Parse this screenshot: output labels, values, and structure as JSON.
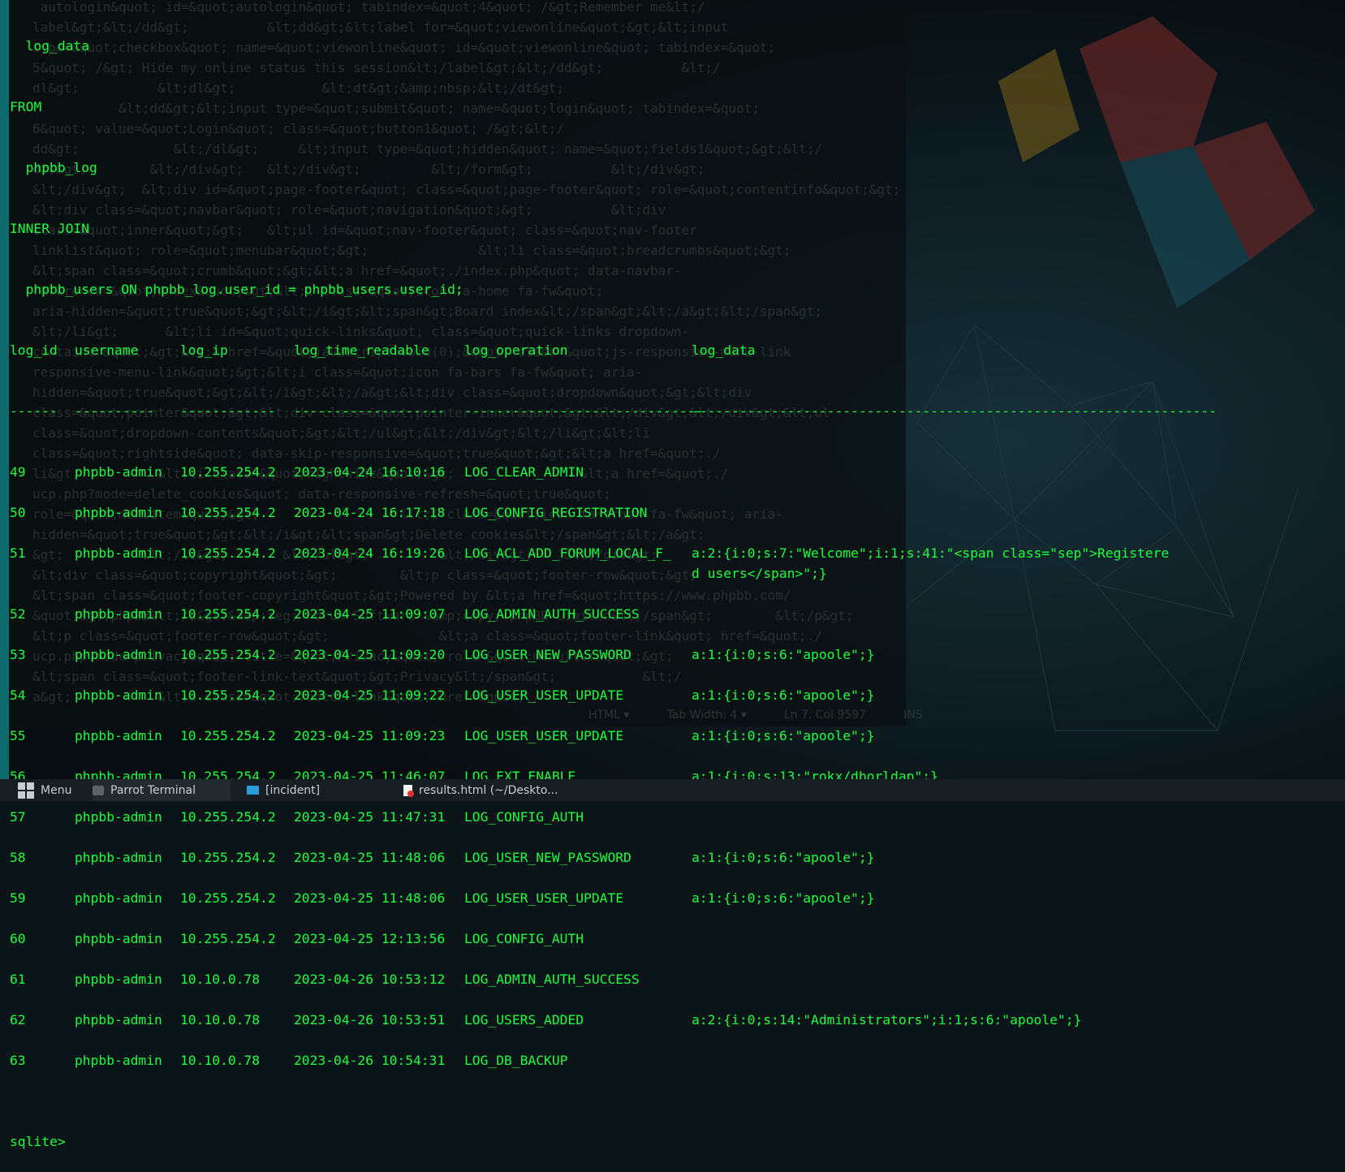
{
  "terminal": {
    "lines": [
      "  log_data",
      "FROM",
      "  phpbb_log",
      "INNER JOIN",
      "  phpbb_users ON phpbb_log.user_id = phpbb_users.user_id;"
    ],
    "columns": [
      "log_id",
      "username",
      "log_ip",
      "log_time_readable",
      "log_operation",
      "log_data"
    ],
    "separators": [
      "------",
      "----------",
      "------------",
      "-------------------",
      "------------------------------",
      "------------------------------------------------------------------"
    ],
    "rows": [
      {
        "log_id": "49",
        "username": "phpbb-admin",
        "log_ip": "10.255.254.2",
        "time": "2023-04-24 16:10:16",
        "operation": "LOG_CLEAR_ADMIN",
        "data": ""
      },
      {
        "log_id": "50",
        "username": "phpbb-admin",
        "log_ip": "10.255.254.2",
        "time": "2023-04-24 16:17:18",
        "operation": "LOG_CONFIG_REGISTRATION",
        "data": ""
      },
      {
        "log_id": "51",
        "username": "phpbb-admin",
        "log_ip": "10.255.254.2",
        "time": "2023-04-24 16:19:26",
        "operation": "LOG_ACL_ADD_FORUM_LOCAL_F_",
        "data": "a:2:{i:0;s:7:\"Welcome\";i:1;s:41:\"<span class=\"sep\">Registere",
        "data2": "d users</span>\";}"
      },
      {
        "log_id": "52",
        "username": "phpbb-admin",
        "log_ip": "10.255.254.2",
        "time": "2023-04-25 11:09:07",
        "operation": "LOG_ADMIN_AUTH_SUCCESS",
        "data": ""
      },
      {
        "log_id": "53",
        "username": "phpbb-admin",
        "log_ip": "10.255.254.2",
        "time": "2023-04-25 11:09:20",
        "operation": "LOG_USER_NEW_PASSWORD",
        "data": "a:1:{i:0;s:6:\"apoole\";}"
      },
      {
        "log_id": "54",
        "username": "phpbb-admin",
        "log_ip": "10.255.254.2",
        "time": "2023-04-25 11:09:22",
        "operation": "LOG_USER_USER_UPDATE",
        "data": "a:1:{i:0;s:6:\"apoole\";}"
      },
      {
        "log_id": "55",
        "username": "phpbb-admin",
        "log_ip": "10.255.254.2",
        "time": "2023-04-25 11:09:23",
        "operation": "LOG_USER_USER_UPDATE",
        "data": "a:1:{i:0;s:6:\"apoole\";}"
      },
      {
        "log_id": "56",
        "username": "phpbb-admin",
        "log_ip": "10.255.254.2",
        "time": "2023-04-25 11:46:07",
        "operation": "LOG_EXT_ENABLE",
        "data": "a:1:{i:0;s:13:\"rokx/dborldap\";}"
      },
      {
        "log_id": "57",
        "username": "phpbb-admin",
        "log_ip": "10.255.254.2",
        "time": "2023-04-25 11:47:31",
        "operation": "LOG_CONFIG_AUTH",
        "data": ""
      },
      {
        "log_id": "58",
        "username": "phpbb-admin",
        "log_ip": "10.255.254.2",
        "time": "2023-04-25 11:48:06",
        "operation": "LOG_USER_NEW_PASSWORD",
        "data": "a:1:{i:0;s:6:\"apoole\";}"
      },
      {
        "log_id": "59",
        "username": "phpbb-admin",
        "log_ip": "10.255.254.2",
        "time": "2023-04-25 11:48:06",
        "operation": "LOG_USER_USER_UPDATE",
        "data": "a:1:{i:0;s:6:\"apoole\";}"
      },
      {
        "log_id": "60",
        "username": "phpbb-admin",
        "log_ip": "10.255.254.2",
        "time": "2023-04-25 12:13:56",
        "operation": "LOG_CONFIG_AUTH",
        "data": ""
      },
      {
        "log_id": "61",
        "username": "phpbb-admin",
        "log_ip": "10.10.0.78",
        "time": "2023-04-26 10:53:12",
        "operation": "LOG_ADMIN_AUTH_SUCCESS",
        "data": ""
      },
      {
        "log_id": "62",
        "username": "phpbb-admin",
        "log_ip": "10.10.0.78",
        "time": "2023-04-26 10:53:51",
        "operation": "LOG_USERS_ADDED",
        "data": "a:2:{i:0;s:14:\"Administrators\";i:1;s:6:\"apoole\";}"
      },
      {
        "log_id": "63",
        "username": "phpbb-admin",
        "log_ip": "10.10.0.78",
        "time": "2023-04-26 10:54:31",
        "operation": "LOG_DB_BACKUP",
        "data": ""
      }
    ],
    "prompt": "sqlite>"
  },
  "background_editor": {
    "lines": [
      " autologin&quot; id=&quot;autologin&quot; tabindex=&quot;4&quot; /&gt;Remember me&lt;/",
      "label&gt;&lt;/dd&gt;          &lt;dd&gt;&lt;label for=&quot;viewonline&quot;&gt;&lt;input",
      "type=&quot;checkbox&quot; name=&quot;viewonline&quot; id=&quot;viewonline&quot; tabindex=&quot;",
      "5&quot; /&gt; Hide my online status this session&lt;/label&gt;&lt;/dd&gt;          &lt;/",
      "dl&gt;          &lt;dl&gt;           &lt;dt&gt;&amp;nbsp;&lt;/dt&gt;",
      "           &lt;dd&gt;&lt;input type=&quot;submit&quot; name=&quot;login&quot; tabindex=&quot;",
      "6&quot; value=&quot;Login&quot; class=&quot;button1&quot; /&gt;&lt;/",
      "dd&gt;            &lt;/dl&gt;     &lt;input type=&quot;hidden&quot; name=&quot;fields1&quot;&gt;&lt;/",
      "div&gt;        &lt;/div&gt;   &lt;/div&gt;         &lt;/form&gt;          &lt;/div&gt;",
      "&lt;/div&gt;  &lt;div id=&quot;page-footer&quot; class=&quot;page-footer&quot; role=&quot;contentinfo&quot;&gt;",
      "&lt;div class=&quot;navbar&quot; role=&quot;navigation&quot;&gt;          &lt;div",
      "class=&quot;inner&quot;&gt;   &lt;ul id=&quot;nav-footer&quot; class=&quot;nav-footer",
      "linklist&quot; role=&quot;menubar&quot;&gt;              &lt;li class=&quot;breadcrumbs&quot;&gt;",
      "&lt;span class=&quot;crumb&quot;&gt;&lt;a href=&quot;./index.php&quot; data-navbar-",
      "reference=&quot;index&quot;&gt;&lt;i class=&quot;icon fa-home fa-fw&quot;",
      "aria-hidden=&quot;true&quot;&gt;&lt;/i&gt;&lt;span&gt;Board index&lt;/span&gt;&lt;/a&gt;&lt;/span&gt;",
      "&lt;/li&gt;      &lt;li id=&quot;quick-links&quot; class=&quot;quick-links dropdown-",
      "container&quot;&gt;&lt;a href=&quot;javascript:void(0);&quot; class=&quot;js-responsive-menu-link",
      "responsive-menu-link&quot;&gt;&lt;i class=&quot;icon fa-bars fa-fw&quot; aria-",
      "hidden=&quot;true&quot;&gt;&lt;/i&gt;&lt;/a&gt;&lt;div class=&quot;dropdown&quot;&gt;&lt;div",
      "class=&quot;pointer&quot;&gt;&lt;div class=&quot;pointer-inner&quot;&gt;&lt;/div&gt;&lt;/div&gt;&lt;ul",
      "class=&quot;dropdown-contents&quot;&gt;&lt;/ul&gt;&lt;/div&gt;&lt;/li&gt;&lt;li",
      "class=&quot;rightside&quot; data-skip-responsive=&quot;true&quot;&gt;&lt;a href=&quot;./",
      "li&gt;          &lt;li class=&quot;rightside&quot;&gt;                &lt;a href=&quot;./",
      "ucp.php?mode=delete_cookies&quot; data-responsive-refresh=&quot;true&quot;",
      "role=&quot;menuitem&quot;&gt;                  &lt;i class=&quot;icon fa-trash fa-fw&quot; aria-",
      "hidden=&quot;true&quot;&gt;&lt;/i&gt;&lt;span&gt;Delete cookies&lt;/span&gt;&lt;/a&gt;",
      "&gt;          &lt;/li&gt;       &lt;/ul&gt;         &lt;/div&gt;    &lt;/div&gt;",
      "&lt;div class=&quot;copyright&quot;&gt;        &lt;p class=&quot;footer-row&quot;&gt;",
      "&lt;span class=&quot;footer-copyright&quot;&gt;Powered by &lt;a href=&quot;https://www.phpbb.com/",
      "&quot;&gt;phpBB&lt;/a&gt;&amp;reg; Forum Software &amp;copy; phpBB Limited&lt;/span&gt;        &lt;/p&gt;",
      "&lt;p class=&quot;footer-row&quot;&gt;              &lt;a class=&quot;footer-link&quot; href=&quot;./",
      "ucp.php?mode=privacy&quot; title=&quot;Privacy&quot; role=&quot;menuitem&quot;&gt;",
      "&lt;span class=&quot;footer-link-text&quot;&gt;Privacy&lt;/span&gt;           &lt;/",
      "a&gt;           &lt;a class=&quot;footer-link&quot; href=&quot;./"
    ],
    "status": [
      "HTML ▾",
      "Tab Width: 4 ▾",
      "Ln 7, Col 9597",
      "INS"
    ]
  },
  "taskbar": {
    "menu_label": "Menu",
    "terminal_label": "Parrot Terminal",
    "folder_label": "[incident]",
    "file_label": "results.html (~/Deskto..."
  }
}
